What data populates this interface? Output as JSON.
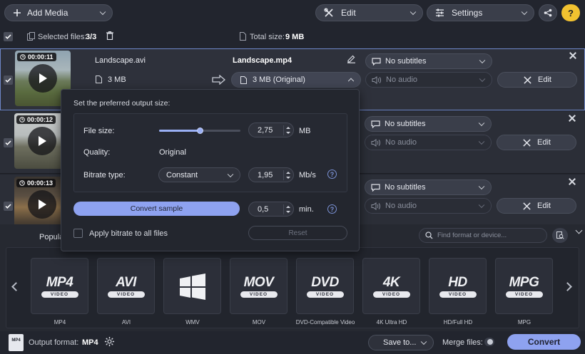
{
  "toolbar": {
    "add_media": "Add Media",
    "edit": "Edit",
    "settings": "Settings"
  },
  "subheader": {
    "selected_label": "Selected files:",
    "selected_value": "3/3",
    "total_label": "Total size:",
    "total_value": "9 MB"
  },
  "files": [
    {
      "duration": "00:00:11",
      "source_name": "Landscape.avi",
      "source_size": "3 MB",
      "output_name": "Landscape.mp4",
      "output_size": "3 MB (Original)",
      "subtitles": "No subtitles",
      "audio": "No audio",
      "edit": "Edit"
    },
    {
      "duration": "00:00:12",
      "subtitles": "No subtitles",
      "audio": "No audio",
      "edit": "Edit"
    },
    {
      "duration": "00:00:13",
      "subtitles": "No subtitles",
      "audio": "No audio",
      "edit": "Edit"
    }
  ],
  "popup": {
    "title": "Set the preferred output size:",
    "file_size_label": "File size:",
    "file_size_value": "2,75",
    "file_size_unit": "MB",
    "file_size_slider": 0.5,
    "quality_label": "Quality:",
    "quality_value": "Original",
    "bitrate_type_label": "Bitrate type:",
    "bitrate_type_value": "Constant",
    "bitrate_value": "1,95",
    "bitrate_unit": "Mb/s",
    "convert_sample": "Convert sample",
    "sample_value": "0,5",
    "sample_unit": "min.",
    "apply_all": "Apply bitrate to all files",
    "reset": "Reset",
    "help_glyph": "?"
  },
  "formats_bar": {
    "tab_partial": "Popula",
    "search_placeholder": "Find format or device..."
  },
  "formats": [
    {
      "logo": "MP4",
      "sub": "VIDEO",
      "label": "MP4"
    },
    {
      "logo": "AVI",
      "sub": "VIDEO",
      "label": "AVI"
    },
    {
      "logo": "",
      "sub": "",
      "label": "WMV",
      "icon": "windows-logo-icon"
    },
    {
      "logo": "MOV",
      "sub": "VIDEO",
      "label": "MOV"
    },
    {
      "logo": "DVD",
      "sub": "VIDEO",
      "label": "DVD-Compatible Video"
    },
    {
      "logo": "4K",
      "sub": "VIDEO",
      "label": "4K Ultra HD"
    },
    {
      "logo": "HD",
      "sub": "VIDEO",
      "label": "HD/Full HD"
    },
    {
      "logo": "MPG",
      "sub": "VIDEO",
      "label": "MPG"
    }
  ],
  "footer": {
    "output_label": "Output format:",
    "output_value": "MP4",
    "save_to": "Save to...",
    "merge_files": "Merge files:",
    "convert": "Convert",
    "format_icon_text": "MP4"
  },
  "colors": {
    "accent": "#8ea2f0",
    "selected_border": "#6f87c8",
    "background": "#22252e"
  }
}
